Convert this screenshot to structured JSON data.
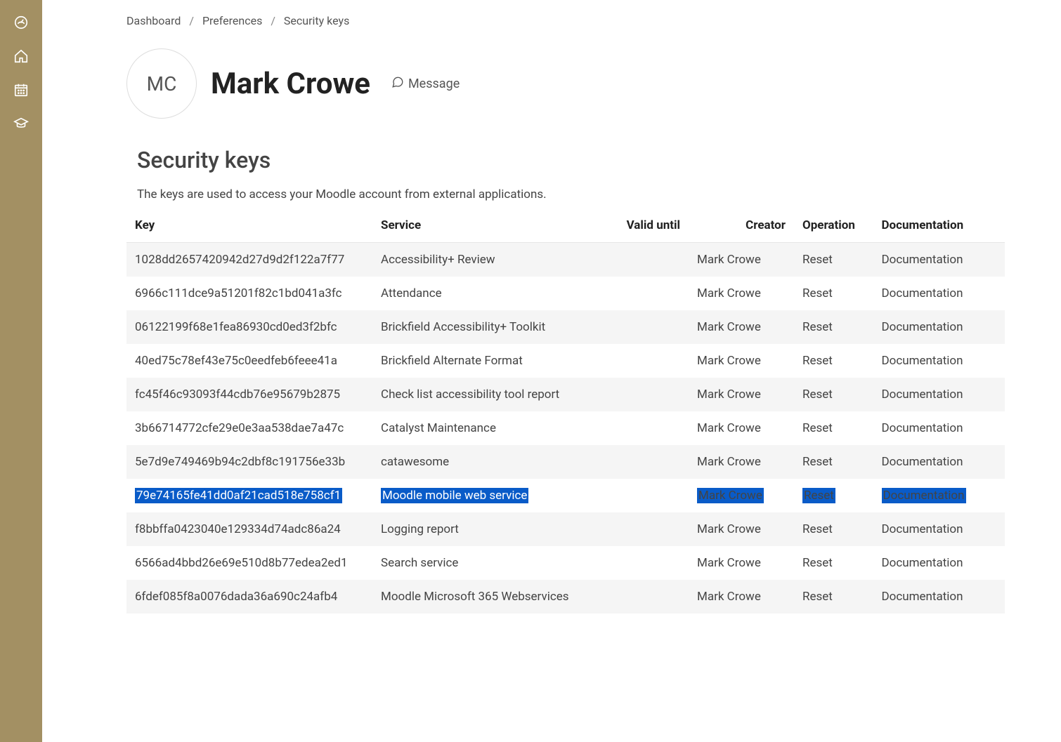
{
  "breadcrumb": {
    "items": [
      "Dashboard",
      "Preferences",
      "Security keys"
    ]
  },
  "profile": {
    "initials": "MC",
    "name": "Mark Crowe",
    "message_label": "Message"
  },
  "page": {
    "title": "Security keys",
    "description": "The keys are used to access your Moodle account from external applications."
  },
  "table": {
    "headers": {
      "key": "Key",
      "service": "Service",
      "valid_until": "Valid until",
      "creator": "Creator",
      "operation": "Operation",
      "documentation": "Documentation"
    },
    "rows": [
      {
        "key": "1028dd2657420942d27d9d2f122a7f77",
        "service": "Accessibility+ Review",
        "valid_until": "",
        "creator": "Mark Crowe",
        "operation": "Reset",
        "documentation": "Documentation",
        "highlight": false
      },
      {
        "key": "6966c111dce9a51201f82c1bd041a3fc",
        "service": "Attendance",
        "valid_until": "",
        "creator": "Mark Crowe",
        "operation": "Reset",
        "documentation": "Documentation",
        "highlight": false
      },
      {
        "key": "06122199f68e1fea86930cd0ed3f2bfc",
        "service": "Brickfield Accessibility+ Toolkit",
        "valid_until": "",
        "creator": "Mark Crowe",
        "operation": "Reset",
        "documentation": "Documentation",
        "highlight": false
      },
      {
        "key": "40ed75c78ef43e75c0eedfeb6feee41a",
        "service": "Brickfield Alternate Format",
        "valid_until": "",
        "creator": "Mark Crowe",
        "operation": "Reset",
        "documentation": "Documentation",
        "highlight": false
      },
      {
        "key": "fc45f46c93093f44cdb76e95679b2875",
        "service": "Check list accessibility tool report",
        "valid_until": "",
        "creator": "Mark Crowe",
        "operation": "Reset",
        "documentation": "Documentation",
        "highlight": false
      },
      {
        "key": "3b66714772cfe29e0e3aa538dae7a47c",
        "service": "Catalyst Maintenance",
        "valid_until": "",
        "creator": "Mark Crowe",
        "operation": "Reset",
        "documentation": "Documentation",
        "highlight": false
      },
      {
        "key": "5e7d9e749469b94c2dbf8c191756e33b",
        "service": "catawesome",
        "valid_until": "",
        "creator": "Mark Crowe",
        "operation": "Reset",
        "documentation": "Documentation",
        "highlight": false
      },
      {
        "key": "79e74165fe41dd0af21cad518e758cf1",
        "service": "Moodle mobile web service",
        "valid_until": "",
        "creator": "Mark Crowe",
        "operation": "Reset",
        "documentation": "Documentation",
        "highlight": true
      },
      {
        "key": "f8bbffa0423040e129334d74adc86a24",
        "service": "Logging report",
        "valid_until": "",
        "creator": "Mark Crowe",
        "operation": "Reset",
        "documentation": "Documentation",
        "highlight": false
      },
      {
        "key": "6566ad4bbd26e69e510d8b77edea2ed1",
        "service": "Search service",
        "valid_until": "",
        "creator": "Mark Crowe",
        "operation": "Reset",
        "documentation": "Documentation",
        "highlight": false
      },
      {
        "key": "6fdef085f8a0076dada36a690c24afb4",
        "service": "Moodle Microsoft 365 Webservices",
        "valid_until": "",
        "creator": "Mark Crowe",
        "operation": "Reset",
        "documentation": "Documentation",
        "highlight": false
      }
    ]
  }
}
